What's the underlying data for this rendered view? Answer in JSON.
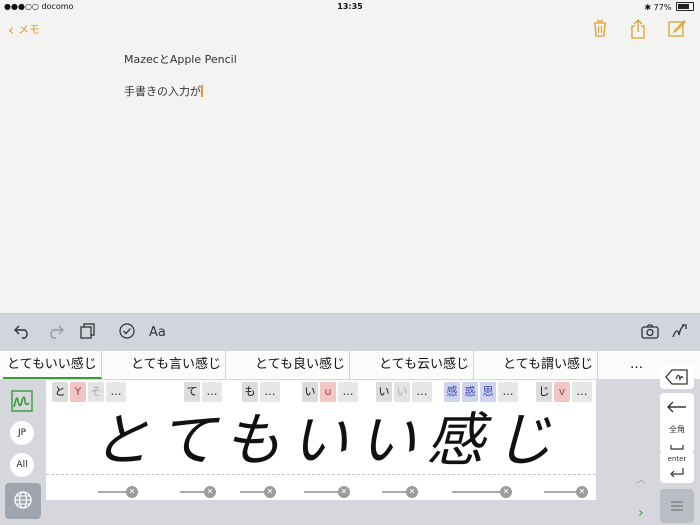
{
  "status": {
    "carrier": "●●●○○ docomo",
    "time": "13:35",
    "battery": "77%",
    "battery_level": 0.77
  },
  "nav": {
    "back_label": "メモ"
  },
  "note": {
    "title": "MazecとApple Pencil",
    "line2": "手書きの入力が"
  },
  "candidates": [
    "とてもいい感じ",
    "とても言い感じ",
    "とても良い感じ",
    "とても云い感じ",
    "とても謂い感じ",
    "…"
  ],
  "segments": {
    "g1": [
      "と",
      "Y",
      "そ",
      "…"
    ],
    "g2": [
      "て",
      "…"
    ],
    "g3": [
      "も",
      "…"
    ],
    "g4": [
      "い",
      "u",
      "…"
    ],
    "g5": [
      "い",
      "い",
      "…"
    ],
    "g6": [
      "感",
      "惑",
      "思",
      "…"
    ],
    "g7": [
      "じ",
      "v",
      "…"
    ]
  },
  "handwriting": "とてもいい感じ",
  "side": {
    "jp": "JP",
    "all": "All"
  },
  "right_keys": {
    "zenkaku": "全角",
    "enter": "enter"
  },
  "colors": {
    "accent": "#e0a12b",
    "candidate_underline": "#3a9b3a"
  }
}
